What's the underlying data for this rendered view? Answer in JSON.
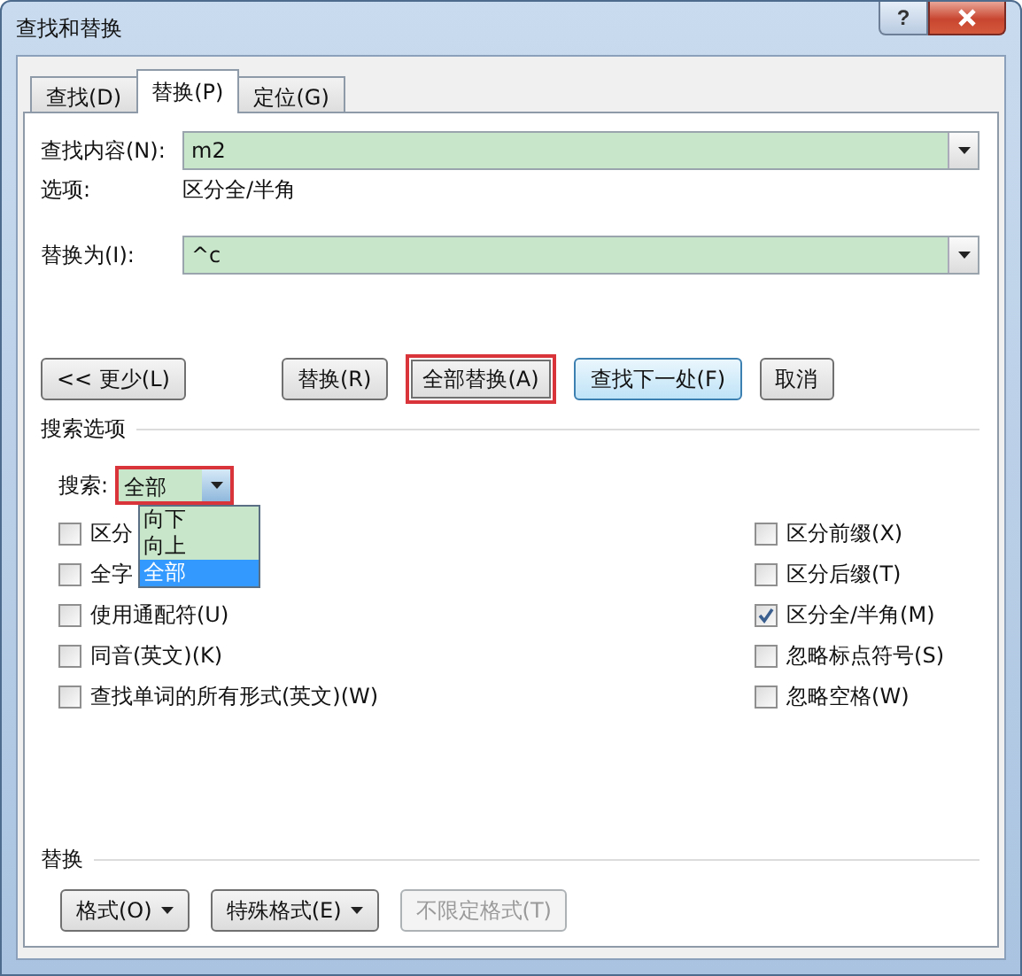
{
  "window": {
    "title": "查找和替换",
    "help": "?"
  },
  "tabs": [
    {
      "label": "查找(D)",
      "selected": false
    },
    {
      "label": "替换(P)",
      "selected": true
    },
    {
      "label": "定位(G)",
      "selected": false
    }
  ],
  "find": {
    "label": "查找内容(N):",
    "value": "m2"
  },
  "options": {
    "label": "选项:",
    "value": "区分全/半角"
  },
  "replace": {
    "label": "替换为(I):",
    "value": "^c"
  },
  "buttons": [
    {
      "label": "<< 更少(L)",
      "highlighted": false,
      "default": false
    },
    {
      "label": "替换(R)",
      "highlighted": false,
      "default": false
    },
    {
      "label": "全部替换(A)",
      "highlighted": true,
      "default": false
    },
    {
      "label": "查找下一处(F)",
      "highlighted": false,
      "default": true
    },
    {
      "label": "取消",
      "highlighted": false,
      "default": false
    }
  ],
  "search_options": {
    "title": "搜索选项",
    "search": {
      "label": "搜索:",
      "value": "全部",
      "highlighted": true,
      "options": [
        {
          "label": "向下",
          "selected": false
        },
        {
          "label": "向上",
          "selected": false
        },
        {
          "label": "全部",
          "selected": true
        }
      ]
    },
    "left_options": [
      {
        "label": "区分",
        "checked": false
      },
      {
        "label": "全字",
        "checked": false
      },
      {
        "label": "使用通配符(U)",
        "checked": false
      },
      {
        "label": "同音(英文)(K)",
        "checked": false
      },
      {
        "label": "查找单词的所有形式(英文)(W)",
        "checked": false
      }
    ],
    "right_options": [
      {
        "label": "区分前缀(X)",
        "checked": false
      },
      {
        "label": "区分后缀(T)",
        "checked": false
      },
      {
        "label": "区分全/半角(M)",
        "checked": true
      },
      {
        "label": "忽略标点符号(S)",
        "checked": false
      },
      {
        "label": "忽略空格(W)",
        "checked": false
      }
    ]
  },
  "replace_section": {
    "title": "替换",
    "buttons": [
      {
        "label": "格式(O)",
        "dropdown": true,
        "disabled": false
      },
      {
        "label": "特殊格式(E)",
        "dropdown": true,
        "disabled": false
      },
      {
        "label": "不限定格式(T)",
        "dropdown": false,
        "disabled": true
      }
    ]
  }
}
